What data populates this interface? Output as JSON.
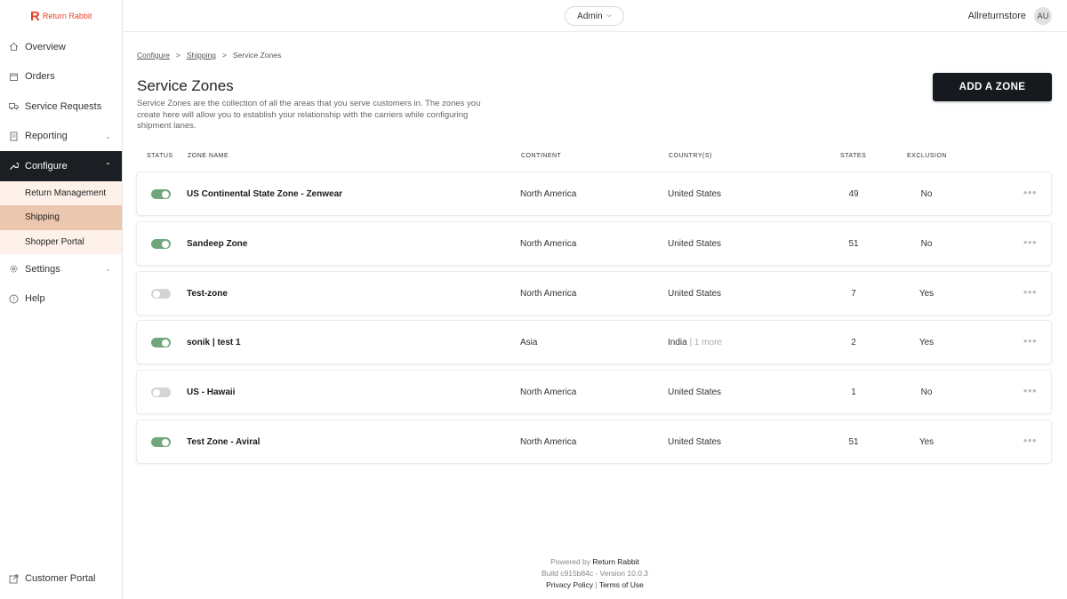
{
  "brand": {
    "mark": "R",
    "name": "Return Rabbit",
    "accent": "#e0452b"
  },
  "sidebar": {
    "items": [
      {
        "label": "Overview",
        "icon": "home-icon"
      },
      {
        "label": "Orders",
        "icon": "box-icon"
      },
      {
        "label": "Service Requests",
        "icon": "truck-icon"
      },
      {
        "label": "Reporting",
        "icon": "report-icon"
      },
      {
        "label": "Configure",
        "icon": "wrench-icon"
      },
      {
        "label": "Settings",
        "icon": "gear-icon"
      },
      {
        "label": "Help",
        "icon": "help-icon"
      }
    ],
    "configure_sub": [
      {
        "label": "Return Management"
      },
      {
        "label": "Shipping"
      },
      {
        "label": "Shopper Portal"
      }
    ],
    "bottom": {
      "label": "Customer Portal",
      "icon": "external-link-icon"
    }
  },
  "topbar": {
    "role": "Admin",
    "store": "Allreturnstore",
    "avatar": "AU"
  },
  "breadcrumb": {
    "c1": "Configure",
    "c2": "Shipping",
    "c3": "Service Zones",
    "sep": ">"
  },
  "page": {
    "title": "Service Zones",
    "description": "Service Zones are the collection of all the areas that you serve customers in. The zones you create here will allow you to establish your relationship with the carriers while configuring shipment lanes.",
    "add_button": "ADD A ZONE"
  },
  "table": {
    "headers": {
      "status": "STATUS",
      "zone": "ZONE NAME",
      "continent": "CONTINENT",
      "country": "COUNTRY(S)",
      "states": "STATES",
      "exclusion": "EXCLUSION"
    },
    "rows": [
      {
        "enabled": true,
        "zone": "US Continental State Zone - Zenwear",
        "continent": "North America",
        "country": "United States",
        "more": "",
        "states": "49",
        "exclusion": "No"
      },
      {
        "enabled": true,
        "zone": "Sandeep Zone",
        "continent": "North America",
        "country": "United States",
        "more": "",
        "states": "51",
        "exclusion": "No"
      },
      {
        "enabled": false,
        "zone": "Test-zone",
        "continent": "North America",
        "country": "United States",
        "more": "",
        "states": "7",
        "exclusion": "Yes"
      },
      {
        "enabled": true,
        "zone": "sonik | test 1",
        "continent": "Asia",
        "country": "India",
        "more": "| 1 more",
        "states": "2",
        "exclusion": "Yes"
      },
      {
        "enabled": false,
        "zone": "US - Hawaii",
        "continent": "North America",
        "country": "United States",
        "more": "",
        "states": "1",
        "exclusion": "No"
      },
      {
        "enabled": true,
        "zone": "Test Zone - Aviral",
        "continent": "North America",
        "country": "United States",
        "more": "",
        "states": "51",
        "exclusion": "Yes"
      }
    ]
  },
  "footer": {
    "powered_prefix": "Powered by",
    "powered_brand": "Return Rabbit",
    "build": "Build c915b84c - Version 10.0.3",
    "privacy": "Privacy Policy",
    "divider": "|",
    "terms": "Terms of Use"
  }
}
